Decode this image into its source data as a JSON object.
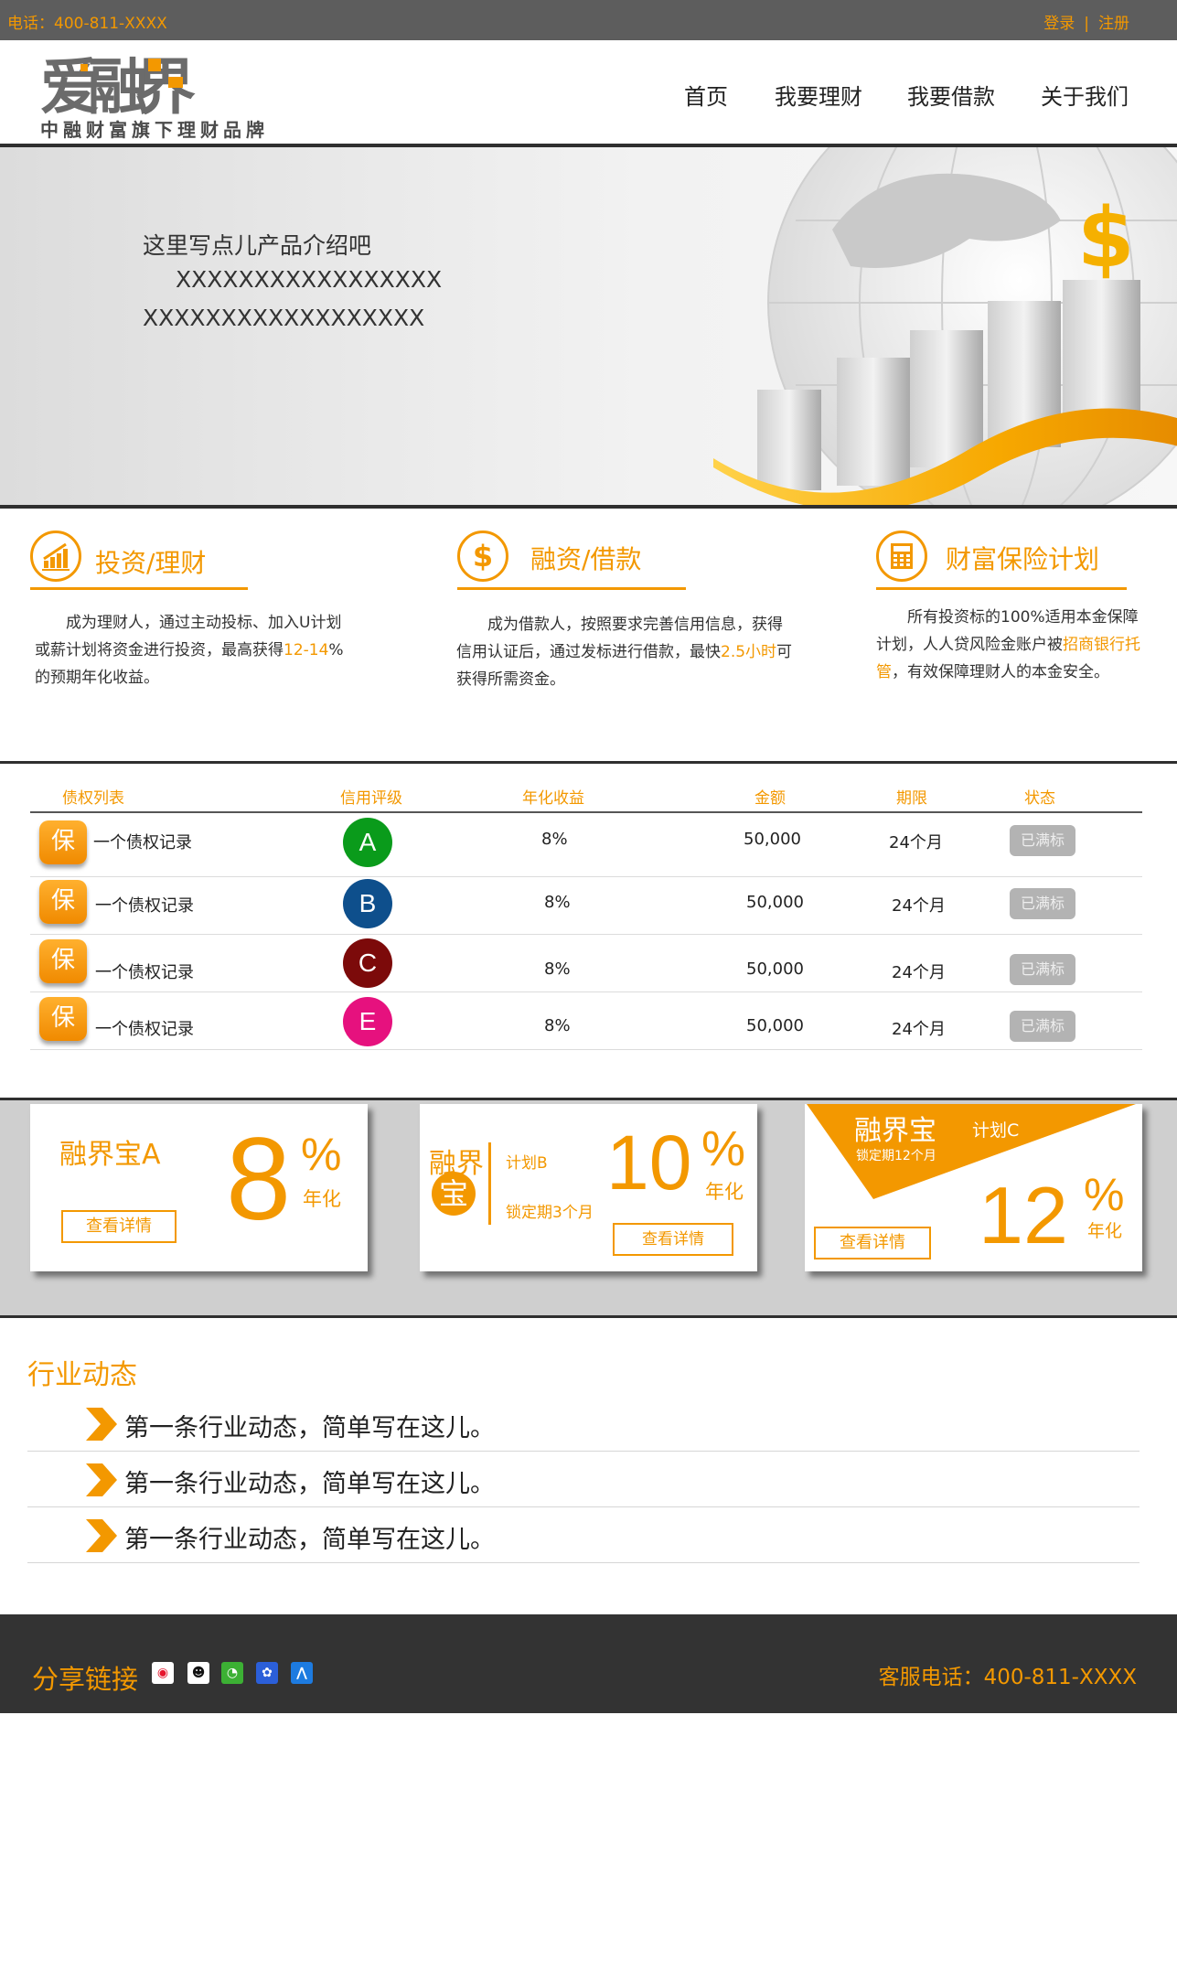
{
  "topbar": {
    "phone": "电话：400-811-XXXX",
    "login": "登录",
    "separator": "|",
    "register": "注册"
  },
  "header": {
    "logo_text": "爱融界",
    "slogan": "中融财富旗下理财品牌",
    "nav": [
      "首页",
      "我要理财",
      "我要借款",
      "关于我们"
    ]
  },
  "banner": {
    "line1": "这里写点儿产品介绍吧",
    "line2": "XXXXXXXXXXXXXXXXX",
    "line3": "XXXXXXXXXXXXXXXXXX"
  },
  "features": [
    {
      "icon": "bar-chart-icon",
      "title": "投资/理财",
      "desc_parts": [
        "成为理财人，通过主动投标、加入U计划",
        "或薪计划将资金进行投资，最高获得",
        "12-14",
        "%",
        "的预期年化收益。"
      ]
    },
    {
      "icon": "dollar-icon",
      "title": "融资/借款",
      "desc_parts": [
        "成为借款人，按照要求完善信用信息，获得",
        "信用认证后，通过发标进行借款，最快",
        "2.5小时",
        "可",
        "获得所需资金。"
      ]
    },
    {
      "icon": "calculator-icon",
      "title": "财富保险计划",
      "desc_parts": [
        "所有投资标的100%适用本金保障",
        "计划，人人贷风险金账户被",
        "招商银行托",
        "管",
        "，有效保障理财人的本金安全。"
      ]
    }
  ],
  "table": {
    "headers": [
      "债权列表",
      "信用评级",
      "年化收益",
      "金额",
      "期限",
      "状态"
    ],
    "rows": [
      {
        "badge": "保",
        "name": "一个债权记录",
        "grade": "A",
        "grade_color": "#0a9b1b",
        "rate": "8%",
        "amount": "50,000",
        "term": "24个月",
        "status": "已满标"
      },
      {
        "badge": "保",
        "name": "一个债权记录",
        "grade": "B",
        "grade_color": "#0e4f8c",
        "rate": "8%",
        "amount": "50,000",
        "term": "24个月",
        "status": "已满标"
      },
      {
        "badge": "保",
        "name": "一个债权记录",
        "grade": "C",
        "grade_color": "#7c0a0a",
        "rate": "8%",
        "amount": "50,000",
        "term": "24个月",
        "status": "已满标"
      },
      {
        "badge": "保",
        "name": "一个债权记录",
        "grade": "E",
        "grade_color": "#e6117e",
        "rate": "8%",
        "amount": "50,000",
        "term": "24个月",
        "status": "已满标"
      }
    ]
  },
  "products": [
    {
      "name": "融界宝A",
      "rate": "8",
      "pct": "%",
      "rate_label": "年化",
      "button": "查看详情"
    },
    {
      "name_top": "融界",
      "name_bottom": "宝",
      "plan": "计划B",
      "lock": "锁定期3个月",
      "rate": "10",
      "pct": "%",
      "rate_label": "年化",
      "button": "查看详情"
    },
    {
      "name": "融界宝",
      "plan": "计划C",
      "lock": "锁定期12个月",
      "rate": "12",
      "pct": "%",
      "rate_label": "年化",
      "button": "查看详情"
    }
  ],
  "news": {
    "title": "行业动态",
    "items": [
      "第一条行业动态，简单写在这儿。",
      "第一条行业动态，简单写在这儿。",
      "第一条行业动态，简单写在这儿。"
    ]
  },
  "footer": {
    "share_label": "分享链接",
    "share_icons": [
      "weibo-icon",
      "qq-icon",
      "wechat-icon",
      "baidu-icon",
      "renren-icon"
    ],
    "hotline": "客服电话：400-811-XXXX"
  },
  "colors": {
    "accent": "#f39800",
    "dark": "#333333",
    "topbar": "#5d5d5d"
  }
}
